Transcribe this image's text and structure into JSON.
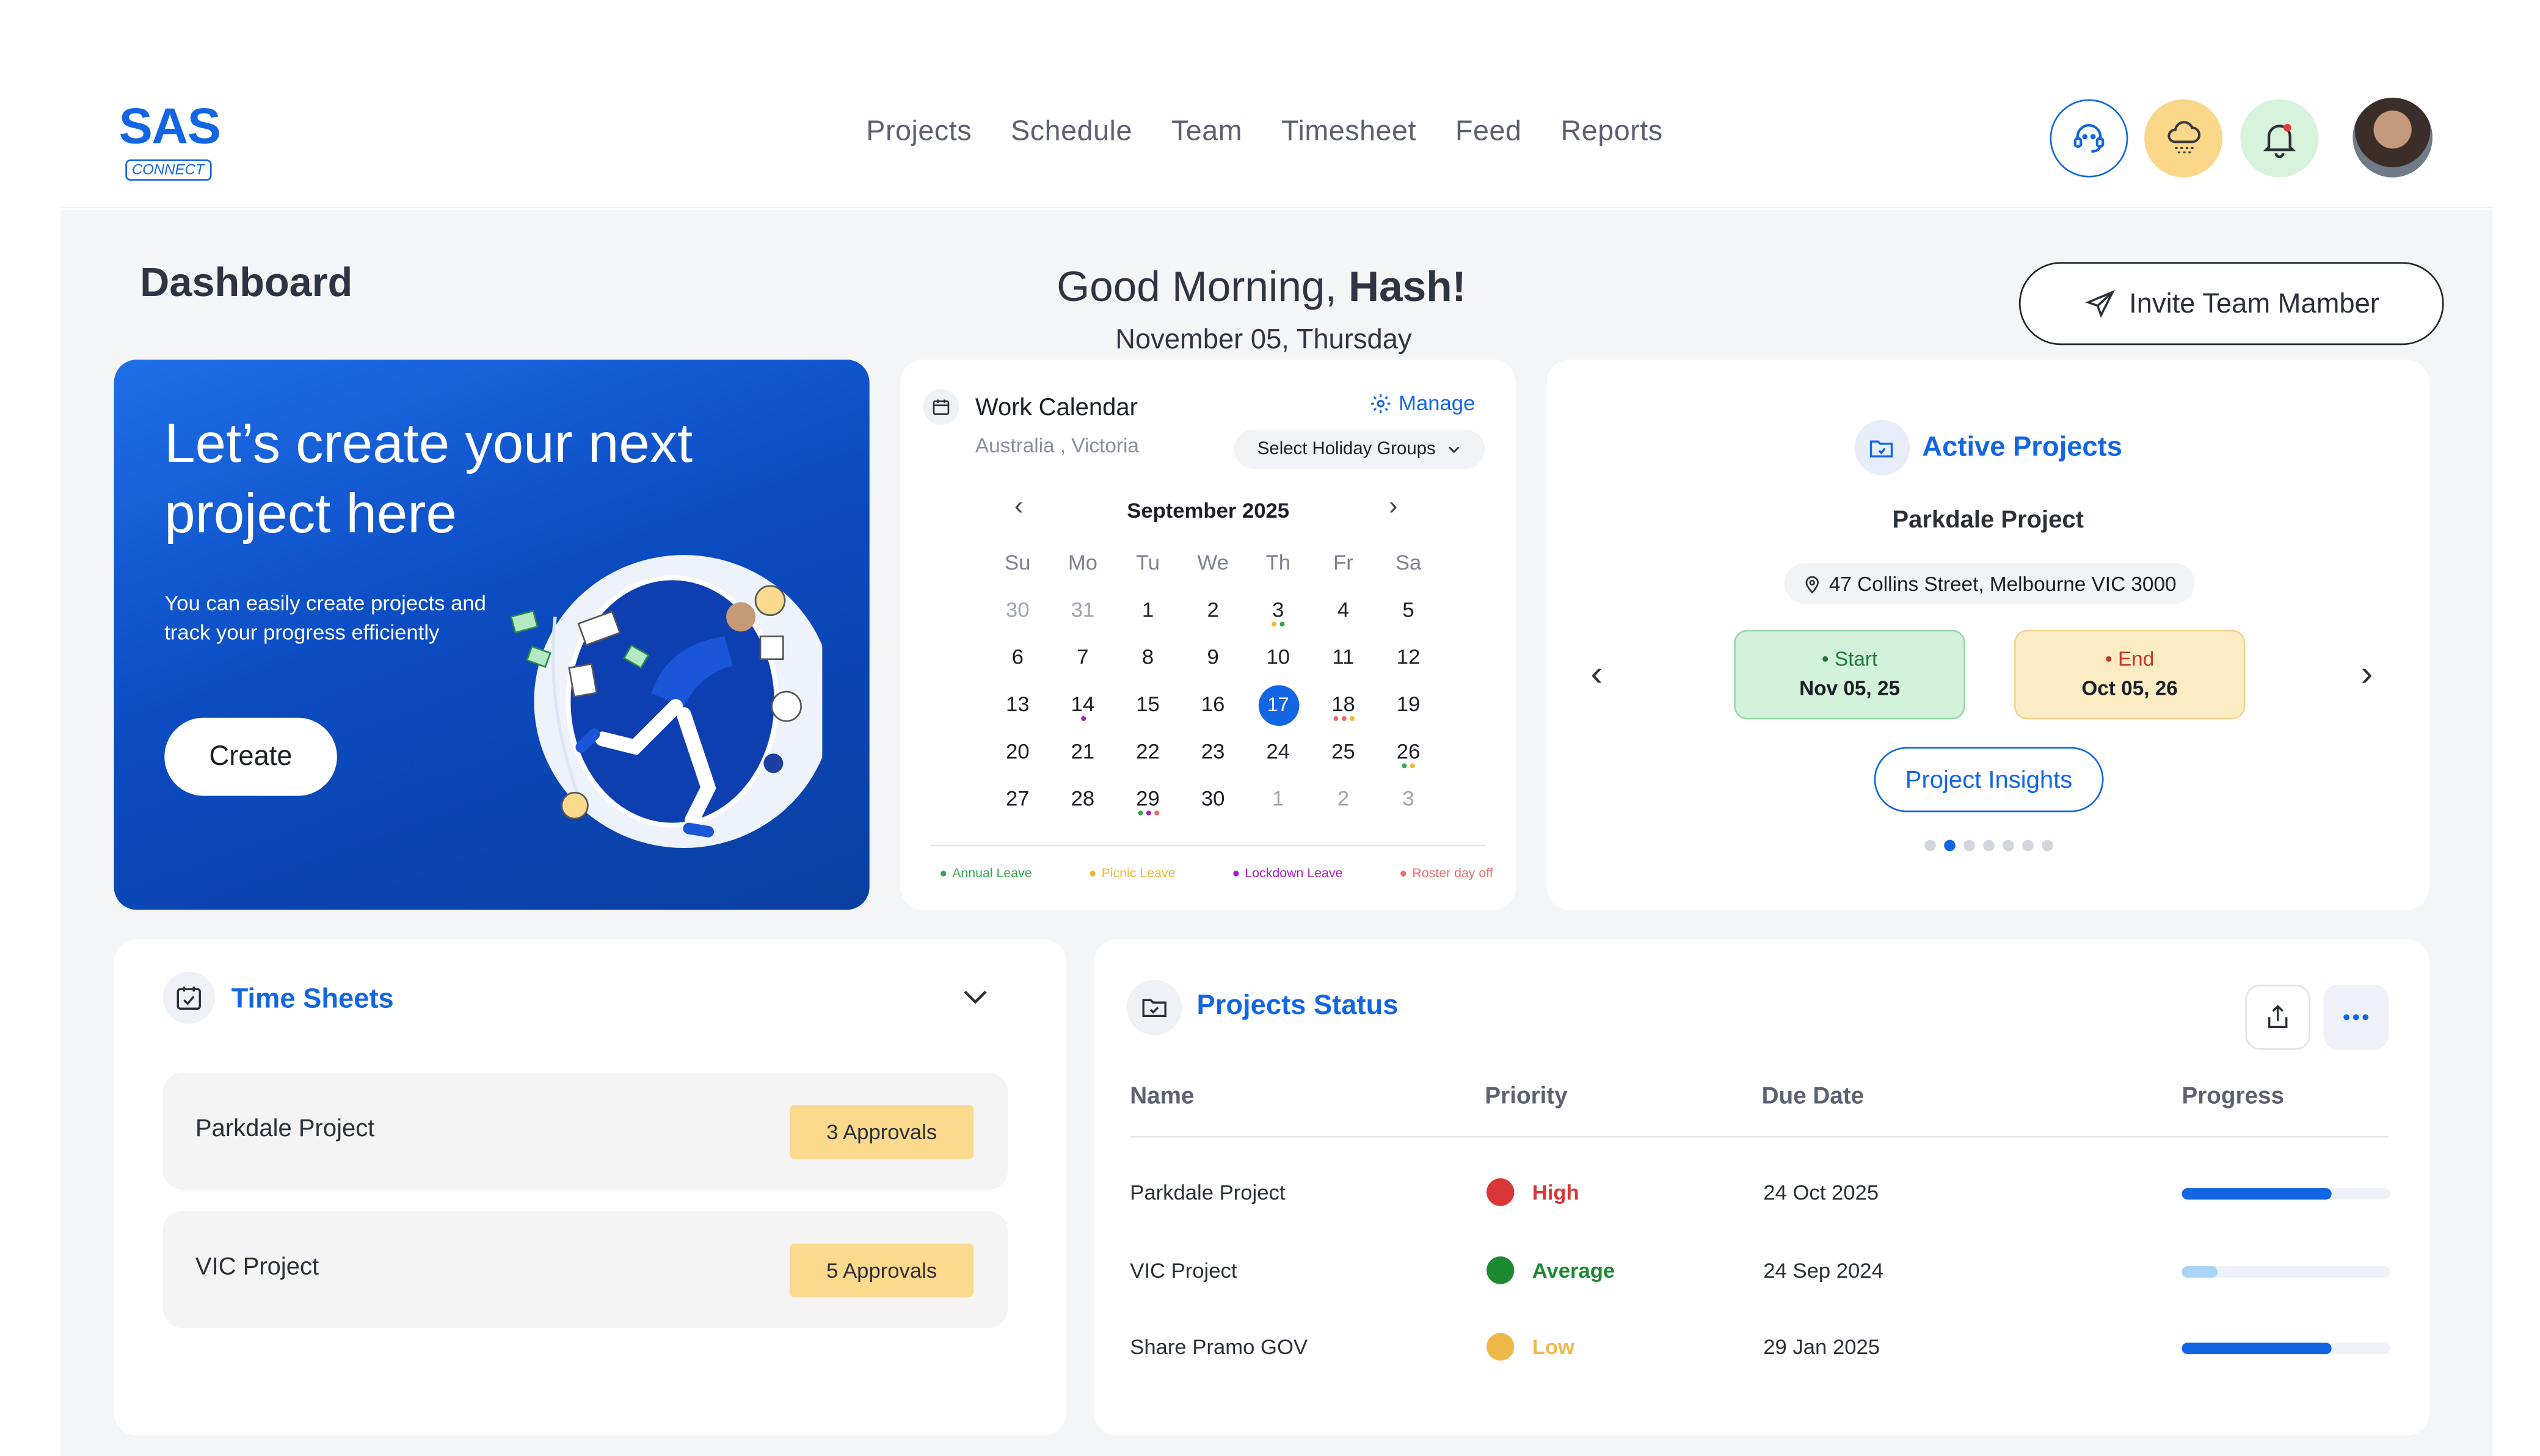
{
  "header": {
    "logo_main": "SAS",
    "logo_sub": "CONNECT",
    "nav": [
      "Projects",
      "Schedule",
      "Team",
      "Timesheet",
      "Feed",
      "Reports"
    ]
  },
  "page": {
    "title": "Dashboard",
    "greeting": "Good Morning,",
    "user": "Hash!",
    "date": "November 05, Thursday",
    "invite_label": "Invite Team Mamber"
  },
  "hero": {
    "heading": "Let’s create your next project here",
    "text": "You can easily create projects and track your progress efficiently",
    "button": "Create"
  },
  "calendar": {
    "title": "Work Calendar",
    "location": "Australia , Victoria",
    "manage": "Manage",
    "holiday_select": "Select Holiday Groups",
    "month": "September 2025",
    "weekdays": [
      "Su",
      "Mo",
      "Tu",
      "We",
      "Th",
      "Fr",
      "Sa"
    ],
    "weeks": [
      [
        "30",
        "31",
        "1",
        "2",
        "3",
        "4",
        "5"
      ],
      [
        "6",
        "7",
        "8",
        "9",
        "10",
        "11",
        "12"
      ],
      [
        "13",
        "14",
        "15",
        "16",
        "17",
        "18",
        "19"
      ],
      [
        "20",
        "21",
        "22",
        "23",
        "24",
        "25",
        "26"
      ],
      [
        "27",
        "28",
        "29",
        "30",
        "1",
        "2",
        "3"
      ]
    ],
    "selected_day": "17",
    "legend": [
      {
        "label": "Annual Leave",
        "color": "#2ea84a"
      },
      {
        "label": "Picnic Leave",
        "color": "#f0b730"
      },
      {
        "label": "Lockdown Leave",
        "color": "#a020c0"
      },
      {
        "label": "Roster day off",
        "color": "#e86a6a"
      }
    ]
  },
  "active_projects": {
    "title": "Active Projects",
    "project": "Parkdale Project",
    "address": "47 Collins Street, Melbourne VIC 3000",
    "start_label": "• Start",
    "start_value": "Nov 05, 25",
    "end_label": "• End",
    "end_value": "Oct 05, 26",
    "insights": "Project Insights",
    "page_count": 7,
    "current_page": 2
  },
  "timesheets": {
    "title": "Time Sheets",
    "rows": [
      {
        "name": "Parkdale Project",
        "badge": "3 Approvals"
      },
      {
        "name": "VIC Project",
        "badge": "5 Approvals"
      }
    ]
  },
  "projects_status": {
    "title": "Projects Status",
    "columns": [
      "Name",
      "Priority",
      "Due Date",
      "Progress"
    ],
    "rows": [
      {
        "name": "Parkdale Project",
        "priority": "High",
        "priority_color": "#d93636",
        "due": "24 Oct 2025",
        "progress": 0.72,
        "bar_color": "#1366e3"
      },
      {
        "name": "VIC Project",
        "priority": "Average",
        "priority_color": "#1d8a32",
        "due": "24 Sep 2024",
        "progress": 0.17,
        "bar_color": "#a8d4f5"
      },
      {
        "name": "Share Pramo GOV",
        "priority": "Low",
        "priority_color": "#efb84a",
        "due": "29 Jan 2025",
        "progress": 0.72,
        "bar_color": "#1366e3"
      }
    ]
  },
  "colors": {
    "accent": "#1366e3"
  }
}
